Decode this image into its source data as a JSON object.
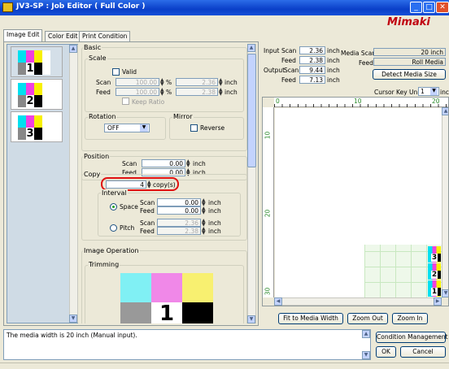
{
  "window": {
    "title": "JV3-SP : Job Editor ( Full Color )",
    "logo": "Mimaki"
  },
  "tabs": [
    "Image Edit",
    "Color Edit",
    "Print Condition"
  ],
  "thumbs": [
    "1",
    "2",
    "3"
  ],
  "basic": {
    "title": "Basic",
    "scale": "Scale",
    "valid": "Valid",
    "scan": "Scan",
    "feed": "Feed",
    "scan_pct": "100.00",
    "feed_pct": "100.00",
    "pct": "%",
    "scan_in": "2.36",
    "feed_in": "2.38",
    "inch": "inch",
    "keep_ratio": "Keep Ratio"
  },
  "rotation": {
    "label": "Rotation",
    "value": "OFF"
  },
  "mirror": {
    "label": "Mirror",
    "reverse": "Reverse"
  },
  "position": {
    "label": "Position",
    "scan": "Scan",
    "feed": "Feed",
    "scan_val": "0.00",
    "feed_val": "0.00",
    "inch": "inch"
  },
  "copy": {
    "label": "Copy",
    "value": "4",
    "unit": "copy(s)",
    "interval": "Interval",
    "space": "Space",
    "pitch": "Pitch",
    "scan": "Scan",
    "feed": "Feed",
    "space_scan": "0.00",
    "space_feed": "0.00",
    "pitch_scan": "2.36",
    "pitch_feed": "2.38",
    "inch": "inch"
  },
  "image_op": {
    "label": "Image Operation",
    "trimming": "Trimming",
    "number": "1"
  },
  "input": {
    "label": "Input",
    "scan": "Scan",
    "feed": "Feed",
    "scan_val": "2.36",
    "feed_val": "2.38",
    "inch": "inch"
  },
  "output": {
    "label": "Output",
    "scan": "Scan",
    "feed": "Feed",
    "scan_val": "9.44",
    "feed_val": "7.13",
    "inch": "inch"
  },
  "media": {
    "scan_label": "Media Scan",
    "feed_label": "Feed",
    "scan_val": "20 inch",
    "feed_val": "Roll Media",
    "detect": "Detect Media Size"
  },
  "cursor": {
    "label": "Cursor Key Unit",
    "value": "1",
    "unit": "inch"
  },
  "ruler": {
    "top": [
      "0",
      "10",
      "20"
    ],
    "left": [
      "10",
      "20",
      "30"
    ]
  },
  "preview_nums": [
    "3",
    "2",
    "1"
  ],
  "buttons": {
    "fit": "Fit to Media Width",
    "zoom_out": "Zoom Out",
    "zoom_in": "Zoom In",
    "condition": "Condition Management",
    "ok": "OK",
    "cancel": "Cancel"
  },
  "status": "The media width is 20 inch (Manual input)."
}
